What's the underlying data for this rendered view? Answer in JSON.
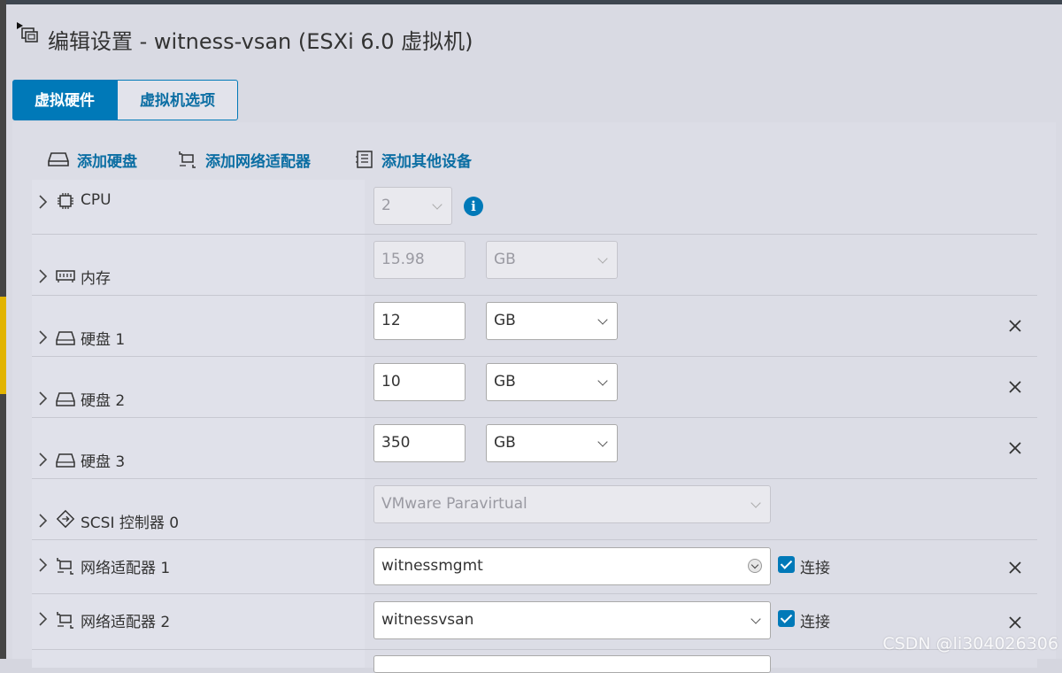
{
  "dialog": {
    "title": "编辑设置 - witness-vsan (ESXi 6.0 虚拟机)"
  },
  "tabs": [
    {
      "label": "虚拟硬件",
      "active": true
    },
    {
      "label": "虚拟机选项",
      "active": false
    }
  ],
  "actions": {
    "add_disk": "添加硬盘",
    "add_network": "添加网络适配器",
    "add_other": "添加其他设备"
  },
  "rows": {
    "cpu": {
      "label": "CPU",
      "value": "2"
    },
    "memory": {
      "label": "内存",
      "value": "15.98",
      "unit": "GB"
    },
    "disk1": {
      "label": "硬盘 1",
      "value": "12",
      "unit": "GB"
    },
    "disk2": {
      "label": "硬盘 2",
      "value": "10",
      "unit": "GB"
    },
    "disk3": {
      "label": "硬盘 3",
      "value": "350",
      "unit": "GB"
    },
    "scsi": {
      "label": "SCSI 控制器 0",
      "value": "VMware Paravirtual"
    },
    "nic1": {
      "label": "网络适配器 1",
      "value": "witnessmgmt",
      "connect_label": "连接",
      "connected": true
    },
    "nic2": {
      "label": "网络适配器 2",
      "value": "witnessvsan",
      "connect_label": "连接",
      "connected": true
    }
  },
  "watermark": "CSDN @li304026306",
  "colors": {
    "accent": "#0079b8",
    "link": "#0b6ea3"
  }
}
